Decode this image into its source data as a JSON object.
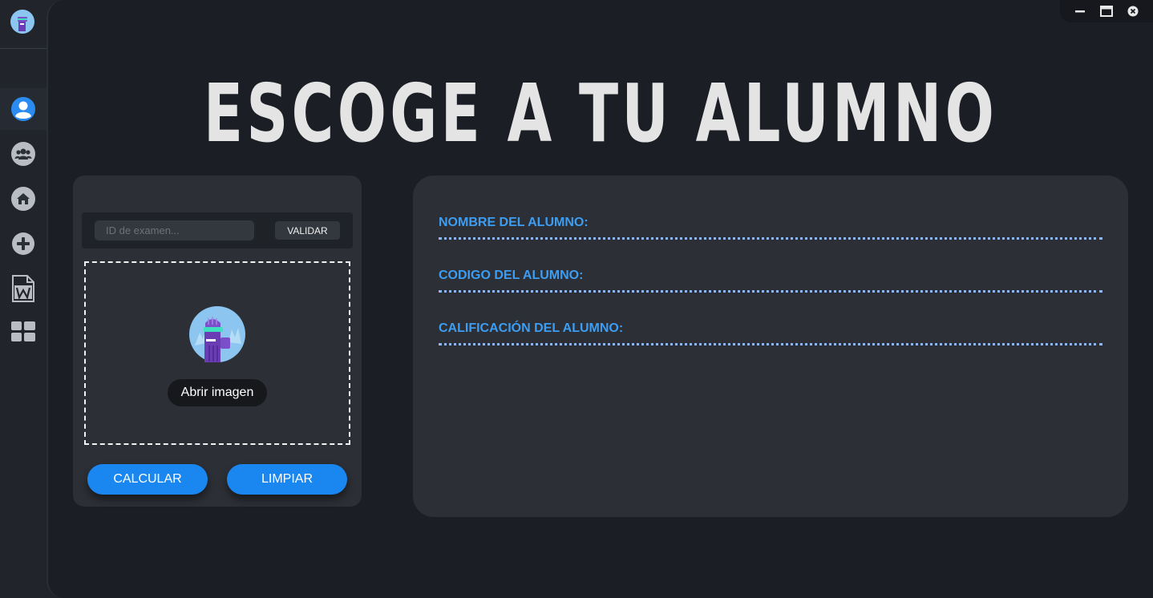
{
  "window": {
    "controls": [
      "minimize",
      "maximize",
      "close"
    ]
  },
  "sidebar": {
    "items": [
      {
        "icon": "user-icon",
        "active": true
      },
      {
        "icon": "group-icon",
        "active": false
      },
      {
        "icon": "home-icon",
        "active": false
      },
      {
        "icon": "plus-icon",
        "active": false
      },
      {
        "icon": "word-document-icon",
        "active": false
      },
      {
        "icon": "grid-icon",
        "active": false
      }
    ]
  },
  "header": {
    "title": "ESCOGE A TU ALUMNO"
  },
  "exam_panel": {
    "id_placeholder": "ID de examen...",
    "id_value": "",
    "validate_label": "VALIDAR",
    "open_image_label": "Abrir imagen",
    "calculate_label": "CALCULAR",
    "clear_label": "LIMPIAR"
  },
  "student_panel": {
    "fields": [
      {
        "label": "NOMBRE DEL ALUMNO:",
        "value": ""
      },
      {
        "label": "CODIGO DEL ALUMNO:",
        "value": ""
      },
      {
        "label": "CALIFICACIÓN DEL ALUMNO:",
        "value": ""
      }
    ]
  },
  "colors": {
    "accent": "#1a86f0",
    "label": "#3d9df2",
    "active_icon": "#2a8cf0",
    "icon": "#b9bcc2"
  }
}
